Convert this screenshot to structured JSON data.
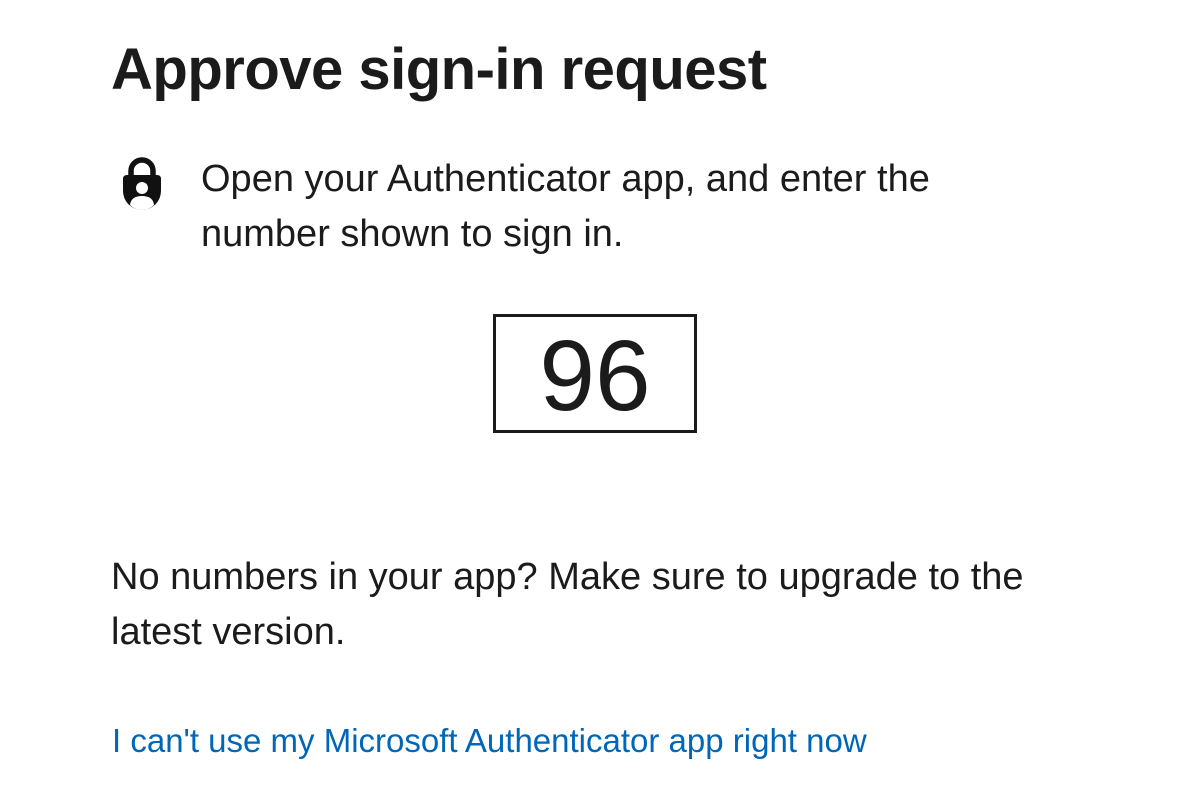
{
  "header": {
    "title": "Approve sign-in request"
  },
  "instruction": {
    "icon": "lock-person-icon",
    "text": "Open your Authenticator app, and enter the number shown to sign in."
  },
  "number_match": {
    "value": "96"
  },
  "upgrade_notice": {
    "text": "No numbers in your app? Make sure to upgrade to the latest version."
  },
  "alternate": {
    "link_label": "I can't use my Microsoft Authenticator app right now"
  },
  "colors": {
    "text": "#1b1b1b",
    "link": "#0067b8",
    "background": "#ffffff"
  }
}
